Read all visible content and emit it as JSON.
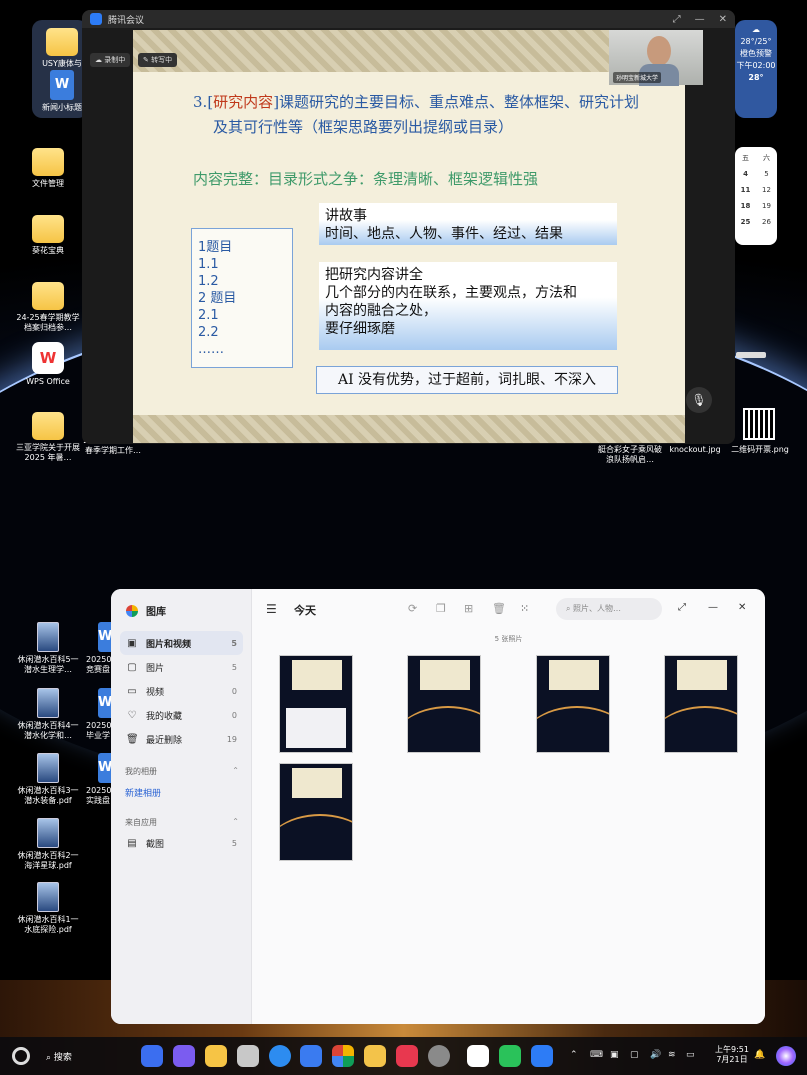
{
  "desktop": {
    "icons_left": [
      {
        "label": "USY康体与",
        "kind": "folder"
      },
      {
        "label": "新闻小标题",
        "kind": "word"
      },
      {
        "label": "文件管理",
        "kind": "folder"
      },
      {
        "label": "葵花宝典",
        "kind": "folder"
      },
      {
        "label": "24-25春学期教学档案归档参…",
        "kind": "folder"
      },
      {
        "label": "WPS Office",
        "kind": "wps"
      },
      {
        "label": "三亚学院关于开展 2025 年暑…",
        "kind": "folder"
      },
      {
        "label": "2024-2025学年春季学期工作…",
        "kind": "folder"
      }
    ],
    "icons_right": [
      {
        "label": "艇合彩女子乘风破浪队扬帆启…"
      },
      {
        "label": "knockout.jpg"
      },
      {
        "label": "二维码开票.png"
      }
    ],
    "pdf_icons": [
      {
        "label": "休闲潜水百科5一潜水生理学…"
      },
      {
        "label": "休闲潜水百科4一潜水化学和…"
      },
      {
        "label": "休闲潜水百科3一潜水装备.pdf"
      },
      {
        "label": "休闲潜水百科2一海洋星球.pdf"
      },
      {
        "label": "休闲潜水百科1一水底探险.pdf"
      }
    ],
    "partial_icons": [
      {
        "label": "202507竞赛盘"
      },
      {
        "label": "202507毕业学"
      },
      {
        "label": "202507实践盘"
      }
    ],
    "weather": {
      "temp_range": "28°/25°",
      "alert": "橙色预警",
      "time": "下午02:00",
      "temp": "28°"
    },
    "calendar": {
      "header": [
        "五",
        "六"
      ],
      "rows": [
        [
          "4",
          "5"
        ],
        [
          "11",
          "12"
        ],
        [
          "18",
          "19"
        ],
        [
          "25",
          "26"
        ]
      ]
    }
  },
  "meeting": {
    "app_title": "腾讯会议",
    "badge_recording": "录制中",
    "badge_transcribing": "转写中",
    "participant_label": "孙明宝新城大学",
    "slide": {
      "heading_num": "3.",
      "heading_bracket_open": "[",
      "heading_highlight": "研究内容",
      "heading_bracket_close": "]",
      "heading_rest": "课题研究的主要目标、重点难点、整体框架、研究计划",
      "heading_line2": "及其可行性等（框架思路要列出提纲或目录）",
      "subheading": "内容完整：目录形式之争：条理清晰、框架逻辑性强",
      "outline": [
        "1题目",
        "1.1",
        "1.2",
        "2 题目",
        "2.1",
        "2.2",
        "……"
      ],
      "box1": [
        "讲故事",
        "时间、地点、人物、事件、经过、结果"
      ],
      "box2": [
        "把研究内容讲全",
        "几个部分的内在联系，主要观点，方法和",
        "内容的融合之处，",
        "要仔细琢磨"
      ],
      "box3": "AI 没有优势，过于超前，词扎眼、不深入"
    }
  },
  "gallery": {
    "app_name": "图库",
    "nav": [
      {
        "label": "图片和视频",
        "count": "5",
        "icon": "photo-video-icon"
      },
      {
        "label": "图片",
        "count": "5",
        "icon": "image-icon"
      },
      {
        "label": "视频",
        "count": "0",
        "icon": "video-icon"
      },
      {
        "label": "我的收藏",
        "count": "0",
        "icon": "heart-icon"
      },
      {
        "label": "最近删除",
        "count": "19",
        "icon": "trash-icon"
      }
    ],
    "section_albums": "我的相册",
    "new_album": "新建相册",
    "section_apps": "来自应用",
    "apps": [
      {
        "label": "截图",
        "count": "5"
      }
    ],
    "title": "今天",
    "search_placeholder": "照片、人物…",
    "photo_count": "5 张照片",
    "thumbnails": 5
  },
  "taskbar": {
    "search_label": "搜索",
    "time": "上午9:51",
    "date": "7月21日"
  },
  "colors": {
    "slide_blue": "#2a5aa3",
    "slide_red": "#c0391b",
    "slide_green": "#3e9a6a",
    "accent_blue": "#2b64d4"
  }
}
